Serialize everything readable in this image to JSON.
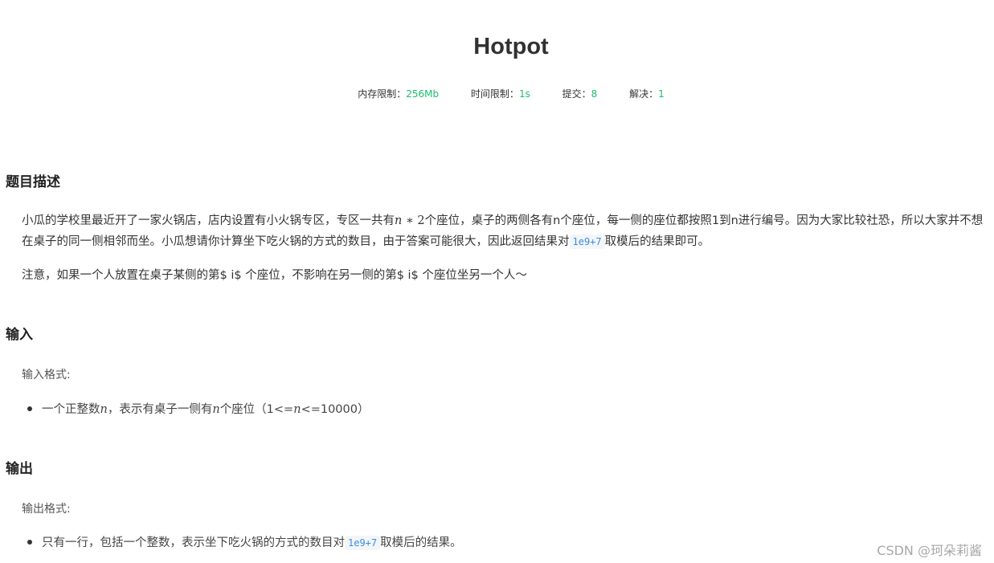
{
  "title": "Hotpot",
  "meta": [
    {
      "label": "内存限制：",
      "value": "256Mb"
    },
    {
      "label": "时间限制：",
      "value": "1s"
    },
    {
      "label": "提交：",
      "value": "8"
    },
    {
      "label": "解决：",
      "value": "1"
    }
  ],
  "description": {
    "heading": "题目描述",
    "p1_a": "小瓜的学校里最近开了一家火锅店，店内设置有小火锅专区，专区一共有",
    "p1_math_n": "n",
    "p1_math_rest": " ∗ 2",
    "p1_b": "个座位，桌子的两侧各有n个座位，每一侧的座位都按照1到n进行编号。因为大家比较社恐，所以大家并不想在桌子的同一侧相邻而坐。小瓜想请你计算坐下吃火锅的方式的数目，由于答案可能很大，因此返回结果对",
    "p1_code": "1e9+7",
    "p1_c": "取模后的结果即可。",
    "p2": "注意，如果一个人放置在桌子某侧的第$ i$ 个座位，不影响在另一侧的第$ i$ 个座位坐另一个人～"
  },
  "input": {
    "heading": "输入",
    "format_label": "输入格式:",
    "bullet_a": "一个正整数",
    "bullet_n1": "n",
    "bullet_b": "，表示有桌子一侧有",
    "bullet_n2": "n",
    "bullet_c": "个座位（1<=",
    "bullet_n3": "n",
    "bullet_d": "<=10000）"
  },
  "output": {
    "heading": "输出",
    "format_label": "输出格式:",
    "bullet_a": "只有一行，包括一个整数，表示坐下吃火锅的方式的数目对",
    "bullet_code": "1e9+7",
    "bullet_b": "取模后的结果。"
  },
  "watermark": "CSDN @珂朵莉酱"
}
